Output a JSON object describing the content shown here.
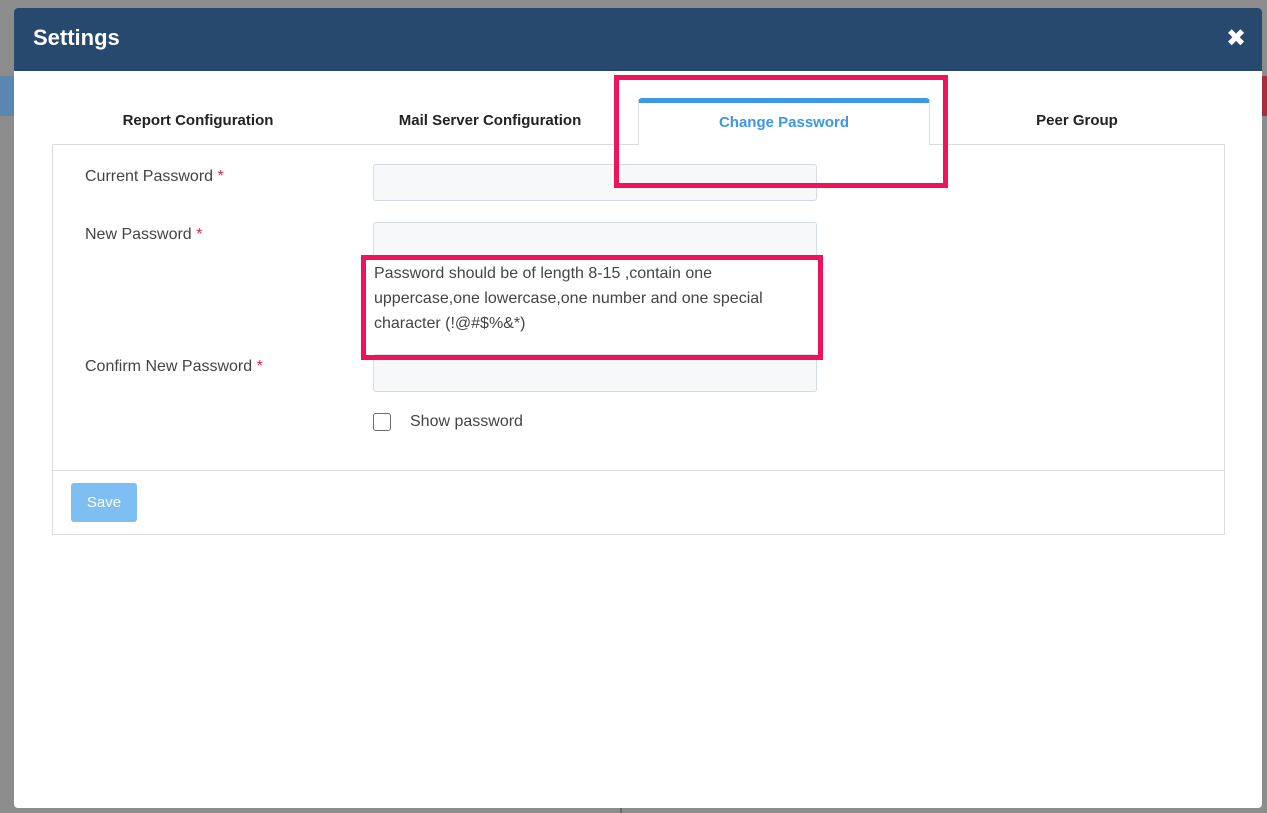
{
  "modal": {
    "title": "Settings",
    "close_icon": "close-icon"
  },
  "tabs": [
    {
      "label": "Report Configuration",
      "active": false
    },
    {
      "label": "Mail Server Configuration",
      "active": false
    },
    {
      "label": "Change Password",
      "active": true
    },
    {
      "label": "Peer Group",
      "active": false
    }
  ],
  "form": {
    "current_password": {
      "label": "Current Password",
      "required_mark": "*",
      "value": ""
    },
    "new_password": {
      "label": "New Password",
      "required_mark": "*",
      "value": ""
    },
    "password_hint": "Password should be of length 8-15 ,contain one uppercase,one lowercase,one number and one special character (!@#$%&*)",
    "confirm_password": {
      "label": "Confirm New Password",
      "required_mark": "*",
      "value": ""
    },
    "show_password": {
      "label": "Show password",
      "checked": false
    },
    "save_label": "Save"
  },
  "colors": {
    "header": "#27496d",
    "accent": "#3d97e6",
    "highlight": "#f0125a",
    "required": "#d9264a",
    "save_button": "#7dbff2"
  }
}
